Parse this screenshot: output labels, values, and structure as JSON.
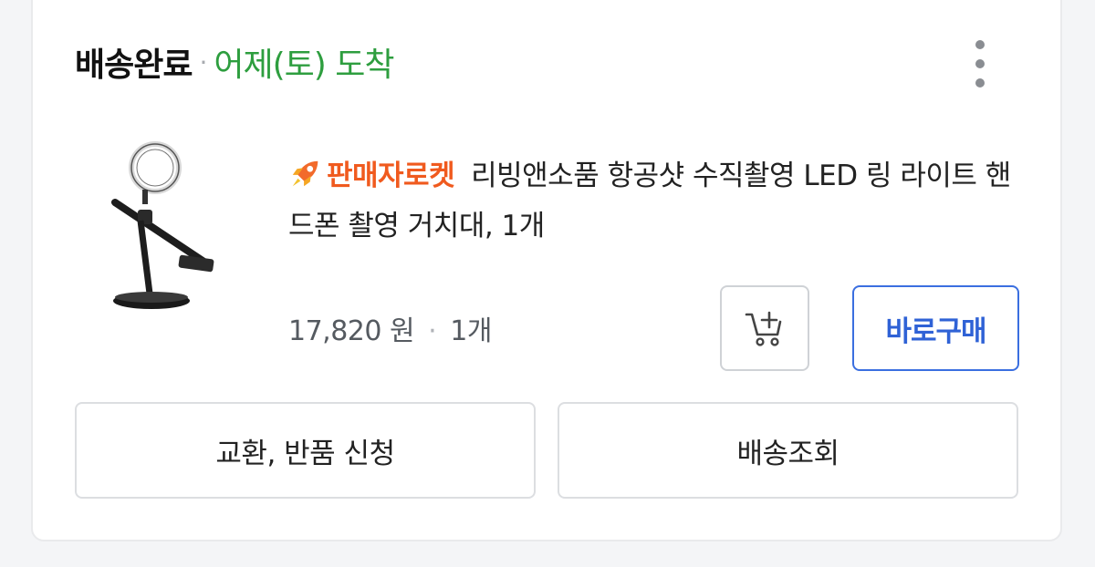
{
  "order": {
    "status": "배송완료",
    "separator": "·",
    "arrival": "어제(토) 도착"
  },
  "product": {
    "badge": "판매자로켓",
    "name": "리빙앤소품 항공샷 수직촬영 LED 링 라이트 핸드폰 촬영 거치대, 1개",
    "price": "17,820 원",
    "price_separator": "·",
    "quantity": "1개"
  },
  "actions": {
    "buy_now": "바로구매",
    "exchange_return": "교환, 반품 신청",
    "track_delivery": "배송조회"
  },
  "icons": {
    "more": "more-vertical-icon",
    "cart_add": "cart-add-icon",
    "rocket": "rocket-icon"
  },
  "colors": {
    "arrival_green": "#2e9e3f",
    "badge_orange": "#f05a1e",
    "buy_blue": "#2f62d6"
  }
}
